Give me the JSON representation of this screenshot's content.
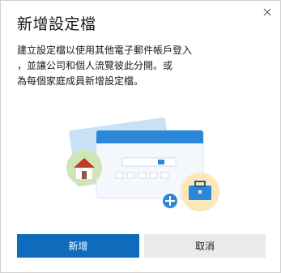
{
  "dialog": {
    "title": "新增設定檔",
    "close_icon": "close-icon",
    "description_lines": [
      "建立設定檔以使用其他電子郵件帳戶登入",
      "，並讓公司和個人流覽彼此分開。或",
      "為每個家庭成員新增設定檔。"
    ],
    "illustration_icons": [
      "house-icon",
      "briefcase-icon",
      "add-icon",
      "browser-window-icon"
    ],
    "buttons": {
      "primary_label": "新增",
      "secondary_label": "取消"
    }
  },
  "colors": {
    "accent": "#0f6cbd",
    "secondary_button": "#eaeaea"
  }
}
